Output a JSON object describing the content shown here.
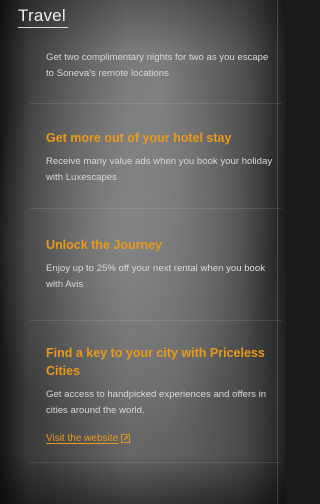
{
  "header": {
    "title": "Travel"
  },
  "cards": [
    {
      "text": "Get two complimentary nights for two as you escape to Soneva's remote locations"
    },
    {
      "title": "Get more out of your hotel stay",
      "text": "Receive many value ads when you book your holiday with Luxescapes"
    },
    {
      "title": "Unlock the Journey",
      "text": "Enjoy up to 25% off your next rental when you book with Avis"
    },
    {
      "title": "Find a key to your city with Priceless Cities",
      "text": "Get access to handpicked experiences and offers in cities around the world.",
      "link": "Visit the website"
    }
  ],
  "colors": {
    "accent": "#e79a1c"
  },
  "icons": {
    "link": "external-link-icon"
  }
}
